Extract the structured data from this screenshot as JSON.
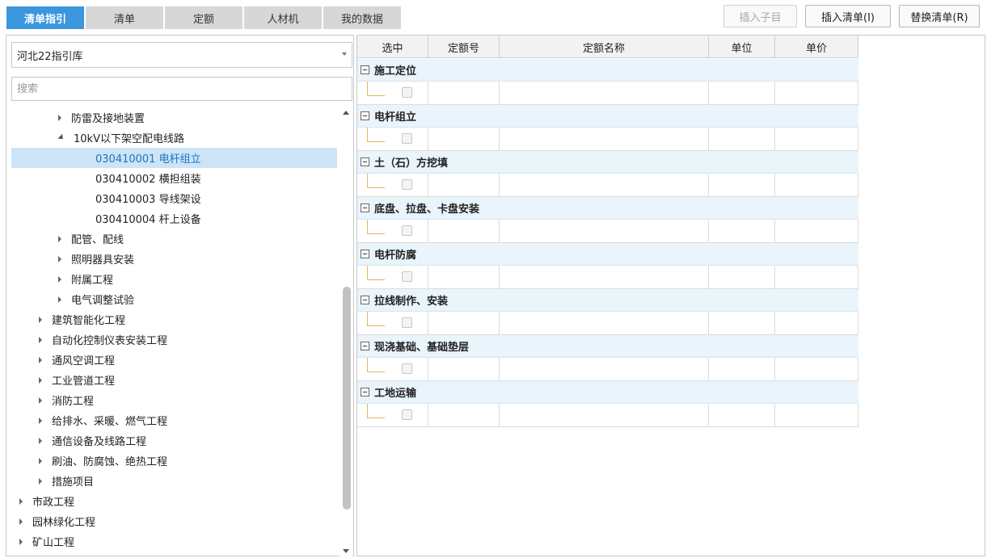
{
  "tabs": [
    {
      "label": "清单指引",
      "active": true
    },
    {
      "label": "清单",
      "active": false
    },
    {
      "label": "定额",
      "active": false
    },
    {
      "label": "人材机",
      "active": false
    },
    {
      "label": "我的数据",
      "active": false
    }
  ],
  "toolbar": {
    "insert_child": "插入子目",
    "insert_list": "插入清单(I)",
    "replace_list": "替换清单(R)"
  },
  "library": {
    "selected": "河北22指引库"
  },
  "search": {
    "placeholder": "搜索"
  },
  "tree": [
    {
      "label": "防雷及接地装置",
      "expanded": false
    },
    {
      "label": "10kV以下架空配电线路",
      "expanded": true
    },
    {
      "label": "030410001  电杆组立",
      "selected": true
    },
    {
      "label": "030410002  横担组装"
    },
    {
      "label": "030410003  导线架设"
    },
    {
      "label": "030410004  杆上设备"
    },
    {
      "label": "配管、配线",
      "expanded": false
    },
    {
      "label": "照明器具安装",
      "expanded": false
    },
    {
      "label": "附属工程",
      "expanded": false
    },
    {
      "label": "电气调整试验",
      "expanded": false
    },
    {
      "label": "建筑智能化工程",
      "expanded": false
    },
    {
      "label": "自动化控制仪表安装工程",
      "expanded": false
    },
    {
      "label": "通风空调工程",
      "expanded": false
    },
    {
      "label": "工业管道工程",
      "expanded": false
    },
    {
      "label": "消防工程",
      "expanded": false
    },
    {
      "label": "给排水、采暖、燃气工程",
      "expanded": false
    },
    {
      "label": "通信设备及线路工程",
      "expanded": false
    },
    {
      "label": "刷油、防腐蚀、绝热工程",
      "expanded": false
    },
    {
      "label": "措施项目",
      "expanded": false
    },
    {
      "label": "市政工程",
      "expanded": false
    },
    {
      "label": "园林绿化工程",
      "expanded": false
    },
    {
      "label": "矿山工程",
      "expanded": false
    }
  ],
  "grid": {
    "columns": [
      "选中",
      "定额号",
      "定额名称",
      "单位",
      "单价"
    ],
    "groups": [
      "施工定位",
      "电杆组立",
      "土（石）方挖填",
      "底盘、拉盘、卡盘安装",
      "电杆防腐",
      "拉线制作、安装",
      "现浇基础、基础垫层",
      "工地运输"
    ]
  }
}
